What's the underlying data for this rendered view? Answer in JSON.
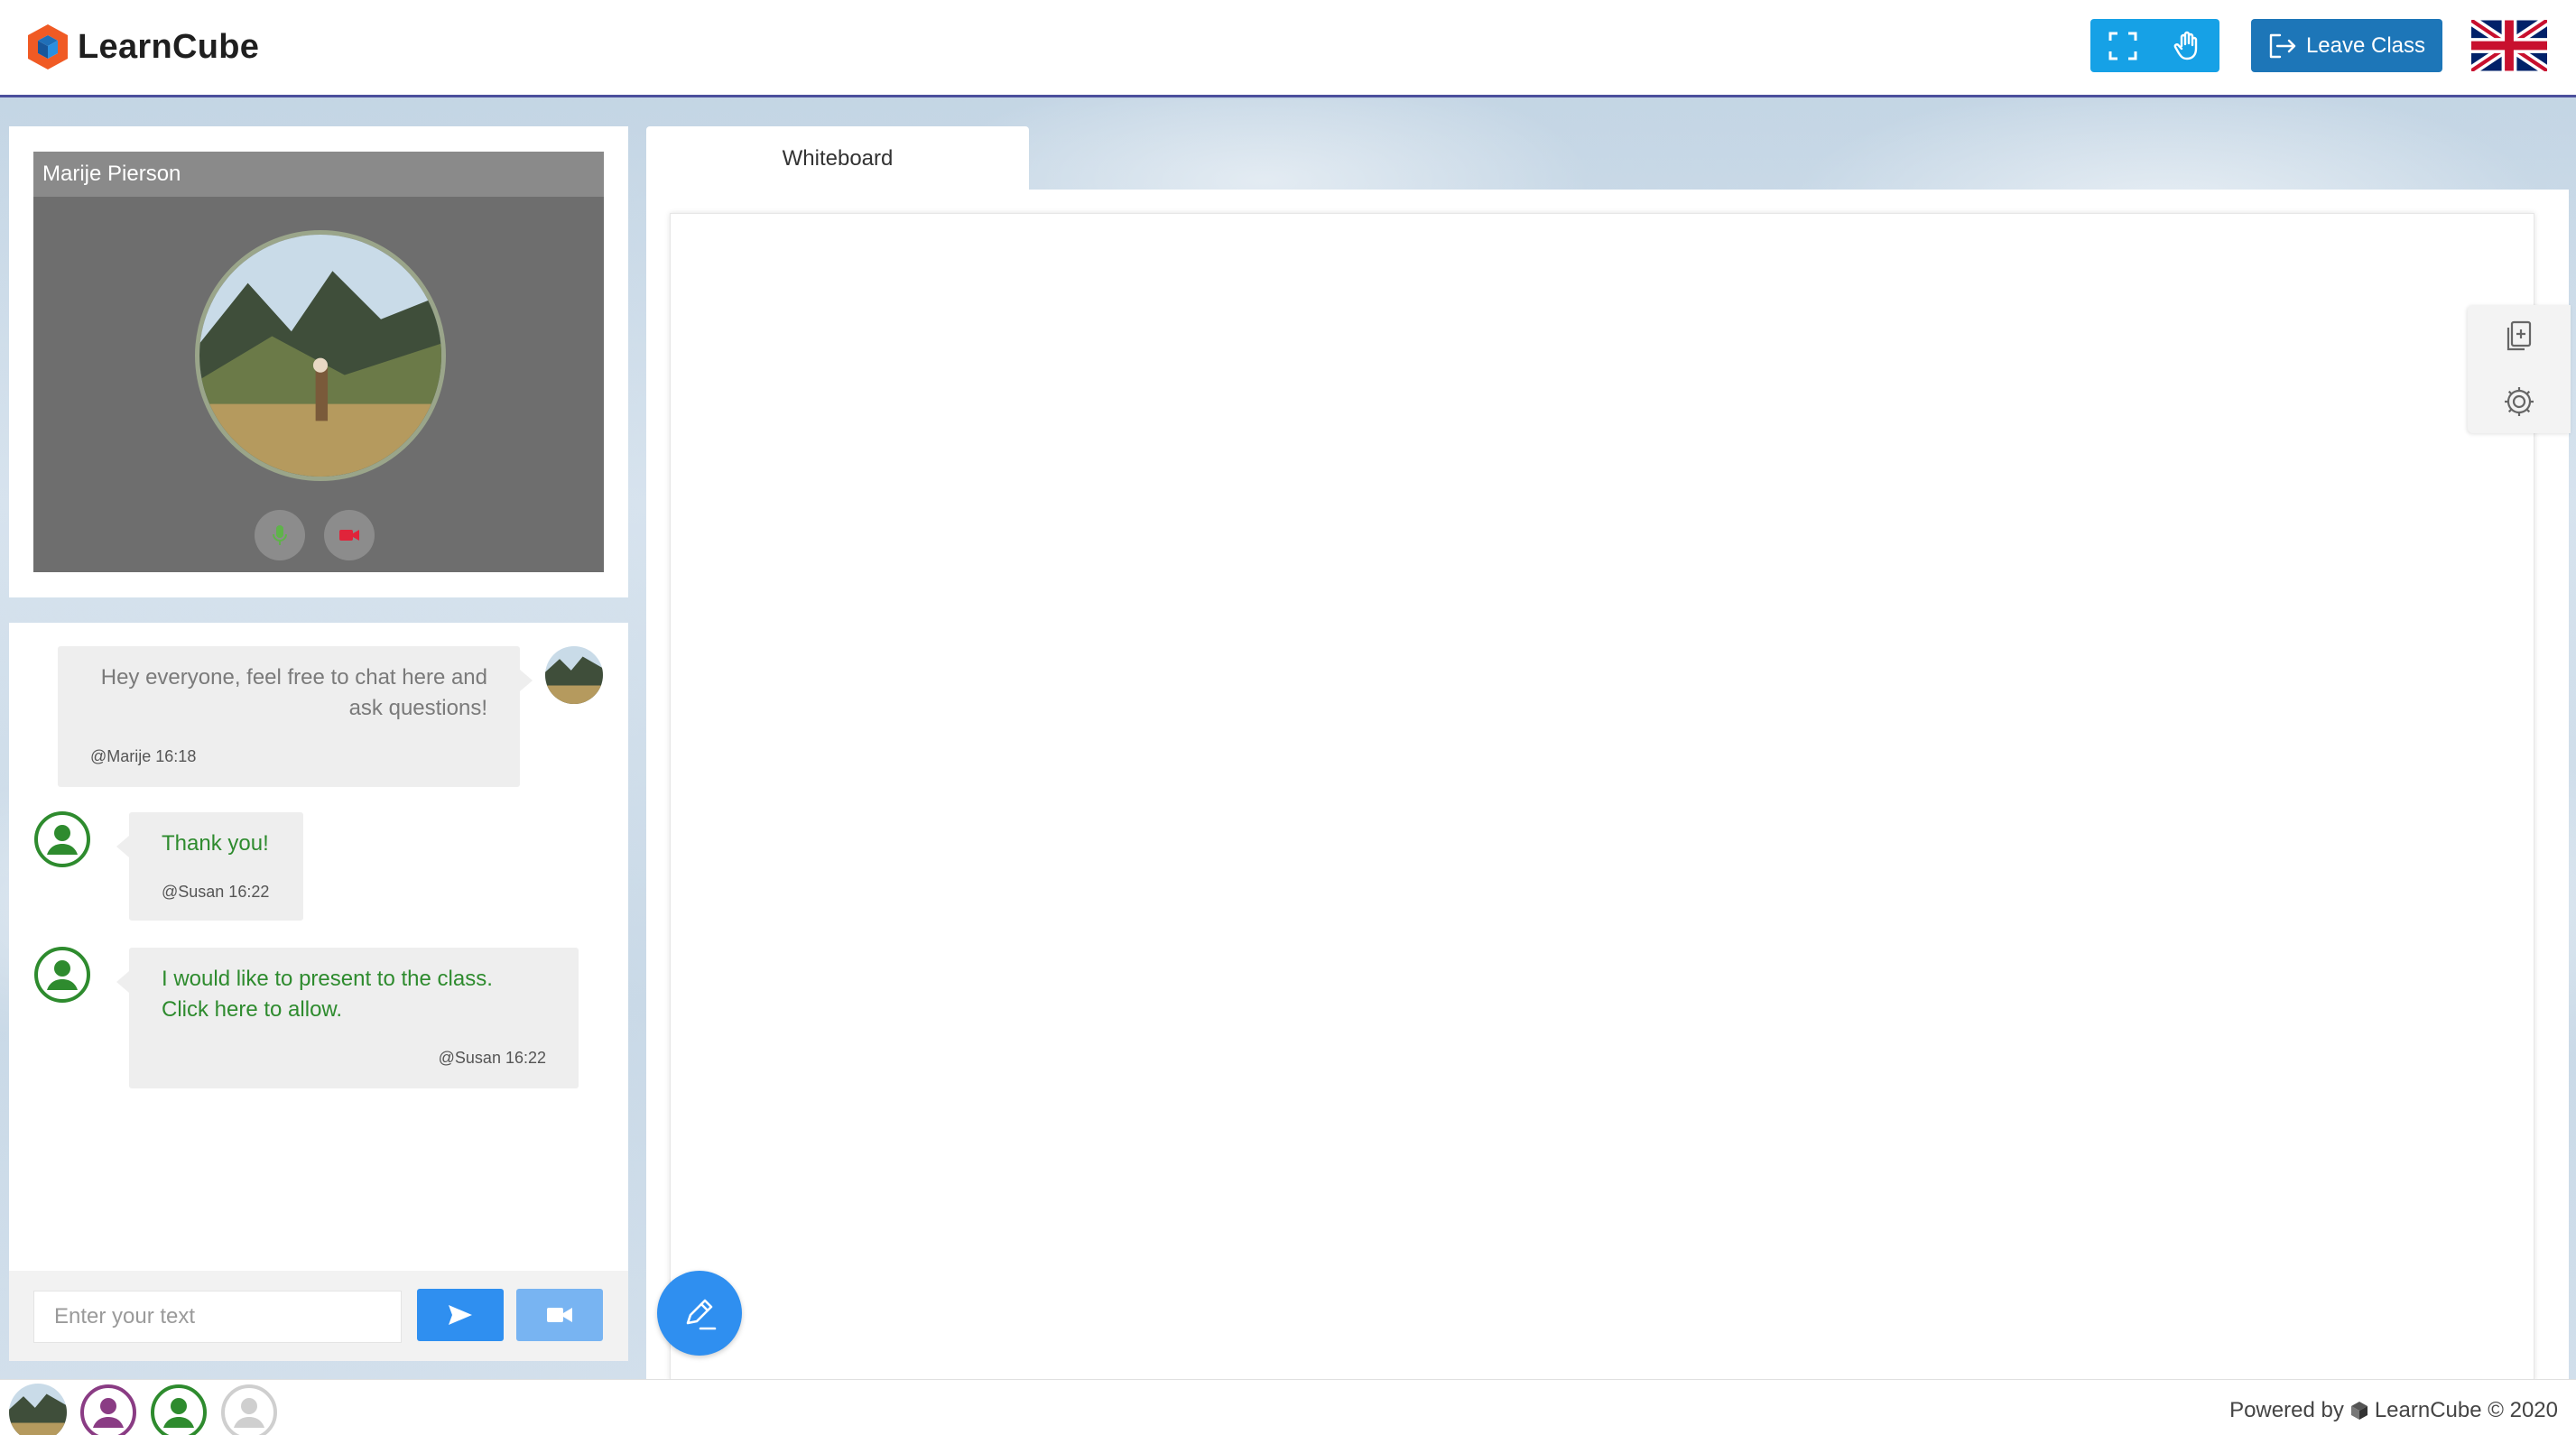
{
  "app": {
    "brand": "LearnCube",
    "brand_color": "#f05a24"
  },
  "header": {
    "fullscreen_icon": "fullscreen-icon",
    "raise_hand_icon": "raise-hand-icon",
    "leave_label": "Leave Class",
    "language_flag": "uk-flag"
  },
  "video": {
    "participant_name": "Marije Pierson",
    "mic_icon": "microphone-icon",
    "camera_icon": "video-camera-icon"
  },
  "chat": {
    "messages": [
      {
        "text_line1": "Hey everyone, feel free to chat here and",
        "text_line2": "ask questions!",
        "meta": "@Marije 16:18",
        "color": "#7a7a7a"
      },
      {
        "text": "Thank you!",
        "meta": "@Susan 16:22",
        "color": "#2e8b2e"
      },
      {
        "text_line1": "I would like to present to the class.",
        "text_line2": "Click here to allow.",
        "meta": "@Susan 16:22",
        "color": "#2e8b2e"
      }
    ],
    "input_placeholder": "Enter your text",
    "send_icon": "send-icon",
    "video_icon": "video-camera-icon"
  },
  "whiteboard": {
    "tab_label": "Whiteboard",
    "add_page_icon": "add-page-icon",
    "settings_icon": "gear-icon",
    "pen_icon": "pen-icon"
  },
  "footer": {
    "powered_prefix": "Powered by",
    "powered_brand": "LearnCube © 2020"
  }
}
